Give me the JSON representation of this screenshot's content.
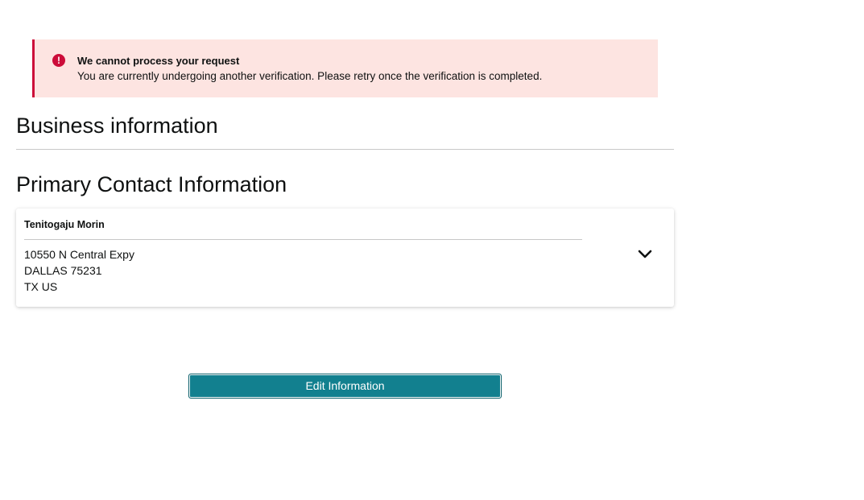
{
  "alert": {
    "type": "error",
    "icon": "exclamation-circle-icon",
    "icon_glyph": "!",
    "title": "We cannot process your request",
    "message": "You are currently undergoing another verification. Please retry once the verification is completed.",
    "background_color": "#fde4e1",
    "accent_color": "#cc0c39"
  },
  "sections": {
    "business_title": "Business information",
    "contact_title": "Primary Contact Information"
  },
  "contact": {
    "name": "Tenitogaju Morin",
    "address_line1": "10550 N Central Expy",
    "address_line2": "DALLAS 75231",
    "address_line3": "TX US",
    "expand_icon": "chevron-down-icon"
  },
  "actions": {
    "edit_label": "Edit Information",
    "edit_color": "#12808f"
  }
}
